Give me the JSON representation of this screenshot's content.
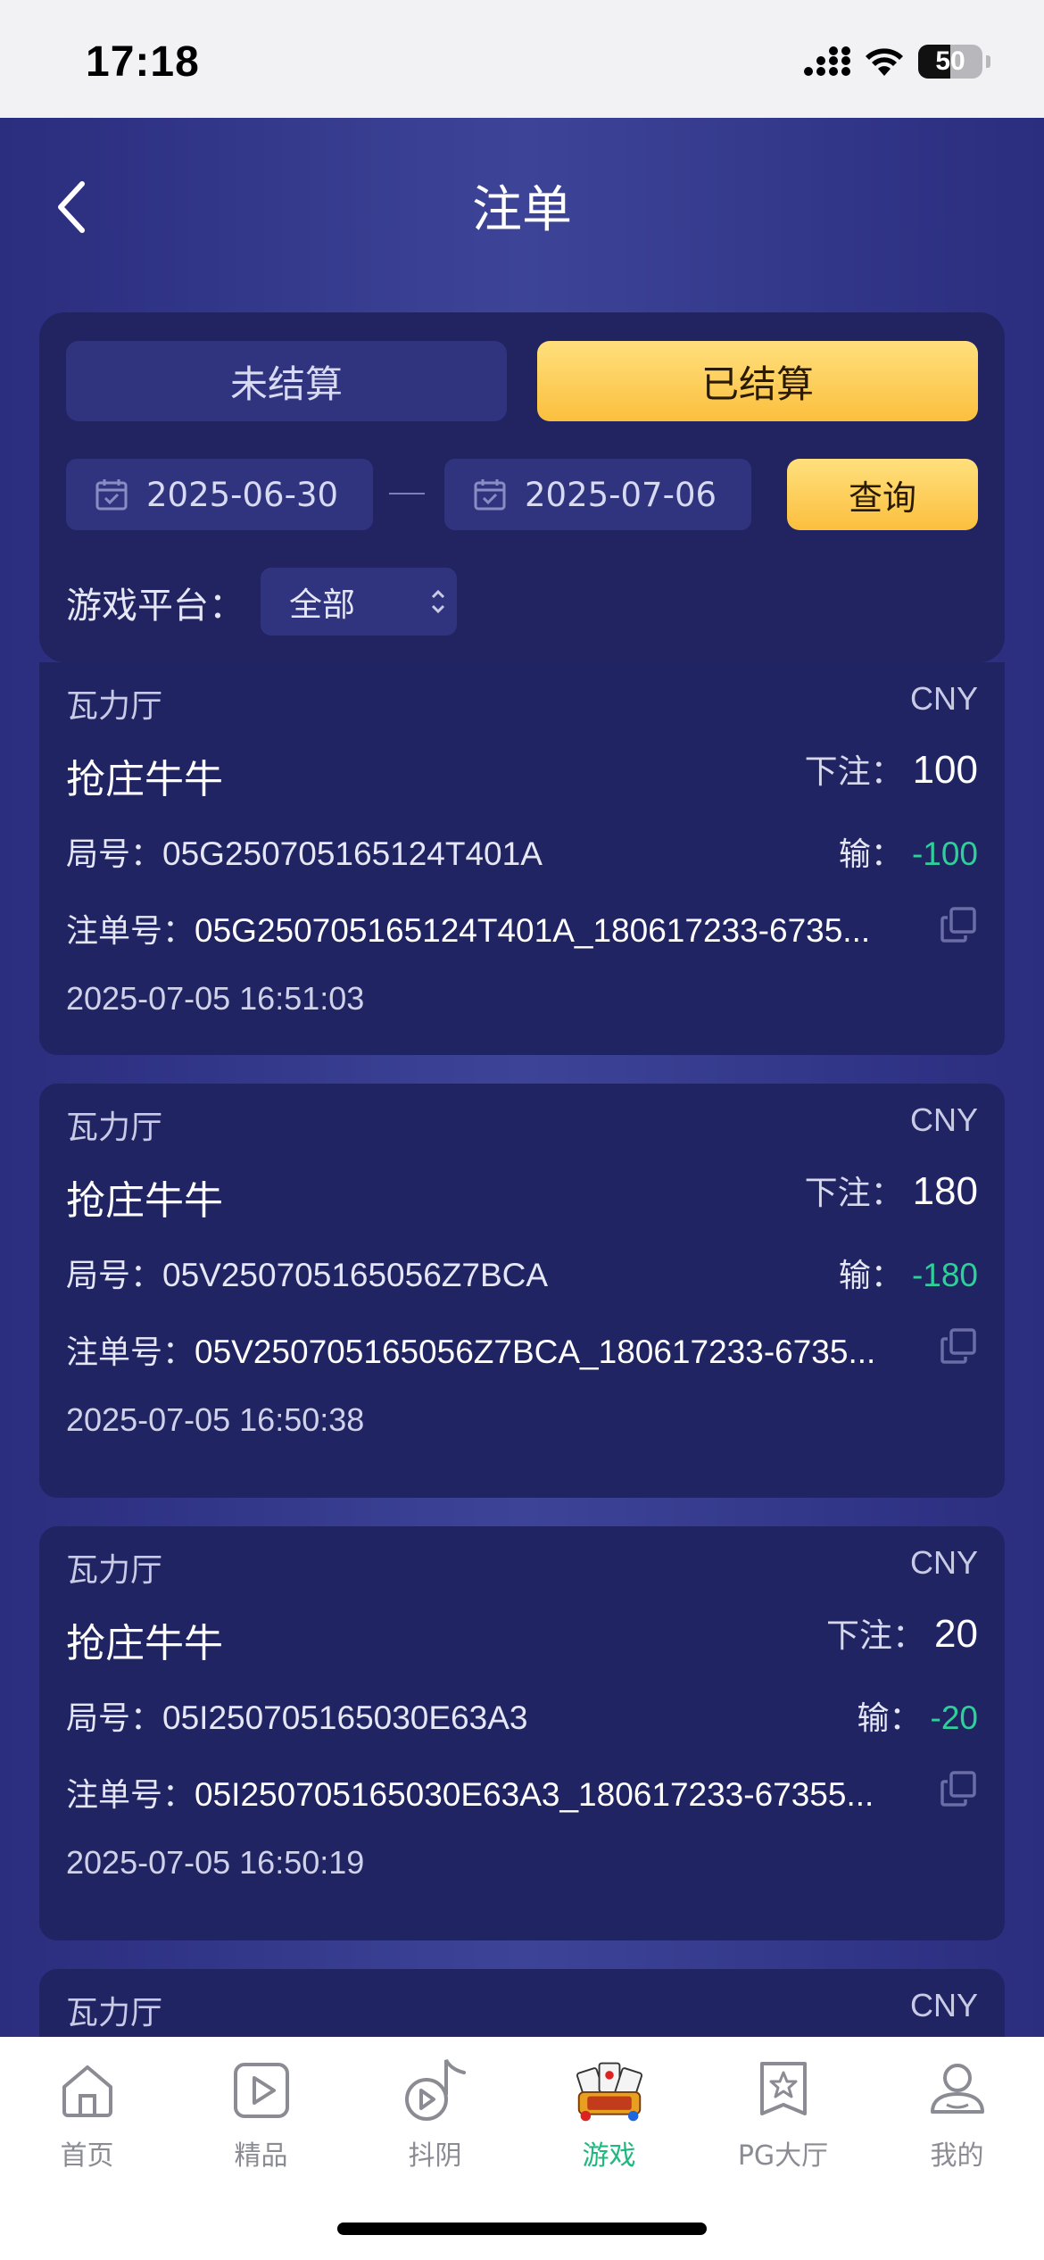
{
  "status_bar": {
    "time": "17:18",
    "battery": "50",
    "battery_level": 0.5
  },
  "header": {
    "title": "注单"
  },
  "tabs": [
    {
      "label": "未结算",
      "active": false
    },
    {
      "label": "已结算",
      "active": true
    }
  ],
  "filter": {
    "date_start": "2025-06-30",
    "date_end": "2025-07-06",
    "query_label": "查询",
    "platform_label": "游戏平台：",
    "platform_value": "全部"
  },
  "labels": {
    "bet": "下注：",
    "round": "局号：",
    "result": "输：",
    "order": "注单号："
  },
  "records": [
    {
      "hall": "瓦力厅",
      "currency": "CNY",
      "game": "抢庄牛牛",
      "bet": "100",
      "round": "05G250705165124T401A",
      "result": "-100",
      "order": "05G250705165124T401A_180617233-6735...",
      "time": "2025-07-05 16:51:03"
    },
    {
      "hall": "瓦力厅",
      "currency": "CNY",
      "game": "抢庄牛牛",
      "bet": "180",
      "round": "05V250705165056Z7BCA",
      "result": "-180",
      "order": "05V250705165056Z7BCA_180617233-6735...",
      "time": "2025-07-05 16:50:38"
    },
    {
      "hall": "瓦力厅",
      "currency": "CNY",
      "game": "抢庄牛牛",
      "bet": "20",
      "round": "05I250705165030E63A3",
      "result": "-20",
      "order": "05I250705165030E63A3_180617233-67355...",
      "time": "2025-07-05 16:50:19"
    },
    {
      "hall": "瓦力厅",
      "currency": "CNY"
    }
  ],
  "nav": [
    {
      "label": "首页",
      "icon": "home-icon",
      "active": false
    },
    {
      "label": "精品",
      "icon": "play-icon",
      "active": false
    },
    {
      "label": "抖阴",
      "icon": "music-play-icon",
      "active": false
    },
    {
      "label": "游戏",
      "icon": "card-game-icon",
      "active": true
    },
    {
      "label": "PG大厅",
      "icon": "star-badge-icon",
      "active": false
    },
    {
      "label": "我的",
      "icon": "profile-icon",
      "active": false
    }
  ],
  "colors": {
    "accent_gold": "#fbbf3e",
    "loss_green": "#2fcf9a",
    "nav_active": "#1db97e",
    "panel": "#222462"
  }
}
